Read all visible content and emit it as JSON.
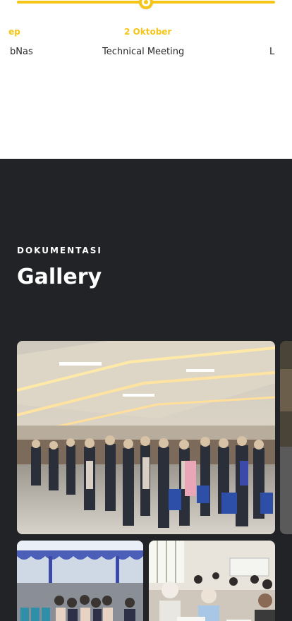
{
  "timeline": {
    "items": [
      {
        "date": "ep",
        "title": "bNas"
      },
      {
        "date": "2 Oktober",
        "title": "Technical Meeting"
      },
      {
        "date": "",
        "title": "L"
      }
    ]
  },
  "gallery": {
    "eyebrow": "DOKUMENTASI",
    "title": "Gallery",
    "photos": [
      {
        "name": "hall-ceremony-photo"
      },
      {
        "name": "tent-audience-photo"
      },
      {
        "name": "classroom-test-photo"
      }
    ]
  },
  "colors": {
    "accent": "#f5c518",
    "dark_bg": "#212326",
    "light_bg": "#ffffff",
    "text_dark": "#2a2a2a"
  }
}
